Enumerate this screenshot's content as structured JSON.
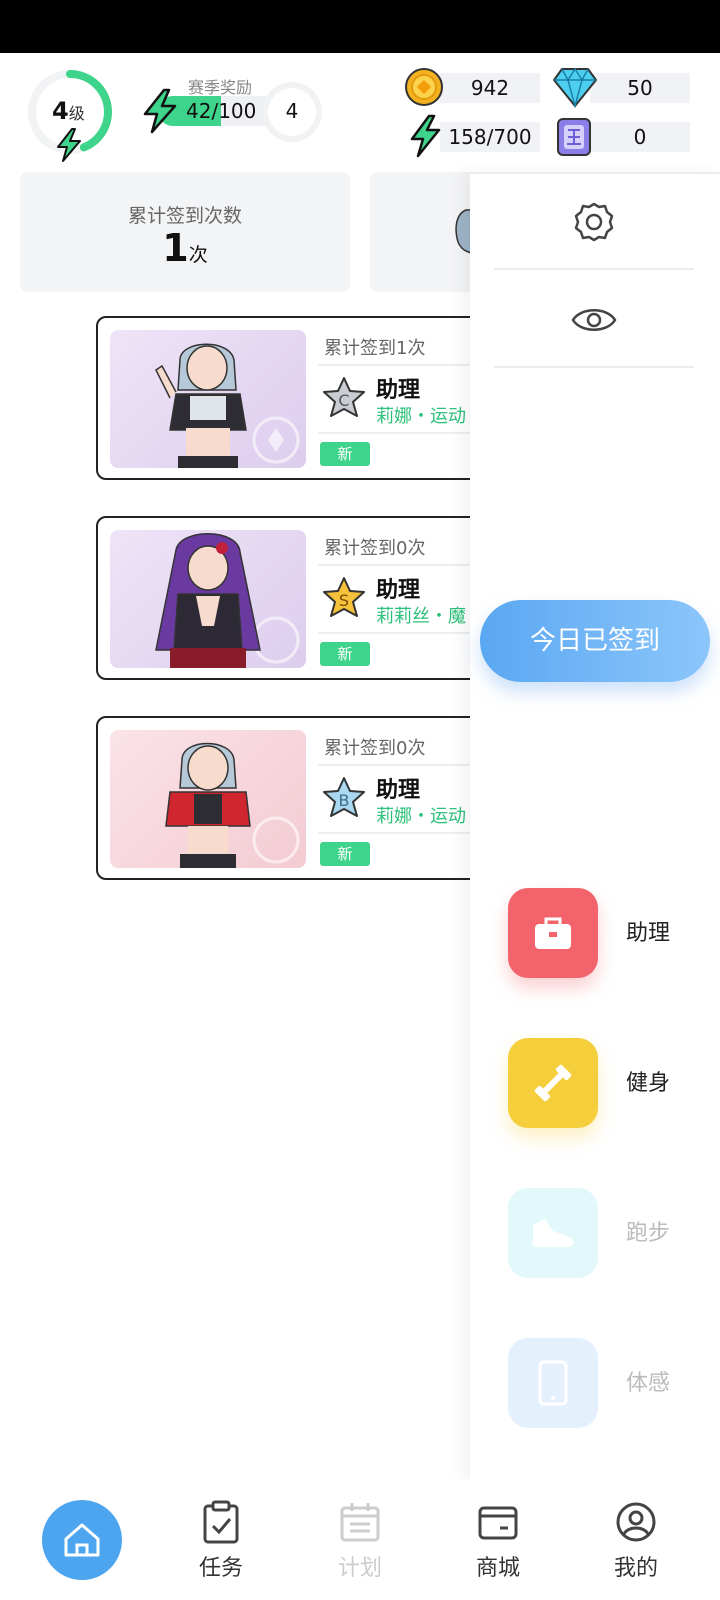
{
  "header": {
    "level_value": "4",
    "level_unit": "级",
    "season_label": "赛季奖励",
    "season_progress_text": "42/100",
    "season_progress": 0.42,
    "season_next_level": "4",
    "coins": "942",
    "gems": "50",
    "energy": "158/700",
    "tickets": "0"
  },
  "stats": {
    "signin_label": "累计签到次数",
    "signin_count": "1",
    "signin_unit": "次"
  },
  "rewards": [
    {
      "count_text": "累计签到1次",
      "grade": "C",
      "title": "助理",
      "subtitle": "莉娜・运动",
      "badge": "新"
    },
    {
      "count_text": "累计签到0次",
      "grade": "S",
      "title": "助理",
      "subtitle": "莉莉丝・魔",
      "badge": "新"
    },
    {
      "count_text": "累计签到0次",
      "grade": "B",
      "title": "助理",
      "subtitle": "莉娜・运动",
      "badge": "新"
    }
  ],
  "side_panel": {
    "settings_icon": "gear-icon",
    "eye_icon": "eye-icon",
    "signed_button": "今日已签到",
    "items": [
      {
        "label": "助理",
        "icon": "briefcase-icon",
        "color": "#f2636b",
        "enabled": true
      },
      {
        "label": "健身",
        "icon": "dumbbell-icon",
        "color": "#f5ce3c",
        "enabled": true
      },
      {
        "label": "跑步",
        "icon": "shoe-icon",
        "color": "#e2f8fb",
        "enabled": false
      },
      {
        "label": "体感",
        "icon": "phone-icon",
        "color": "#e5f0fd",
        "enabled": false
      }
    ]
  },
  "bottom_nav": {
    "home_icon": "home-icon",
    "tabs": [
      {
        "label": "任务",
        "icon": "clipboard-check-icon",
        "enabled": true
      },
      {
        "label": "计划",
        "icon": "calendar-icon",
        "enabled": false
      },
      {
        "label": "商城",
        "icon": "wallet-icon",
        "enabled": true
      },
      {
        "label": "我的",
        "icon": "user-icon",
        "enabled": true
      }
    ]
  }
}
